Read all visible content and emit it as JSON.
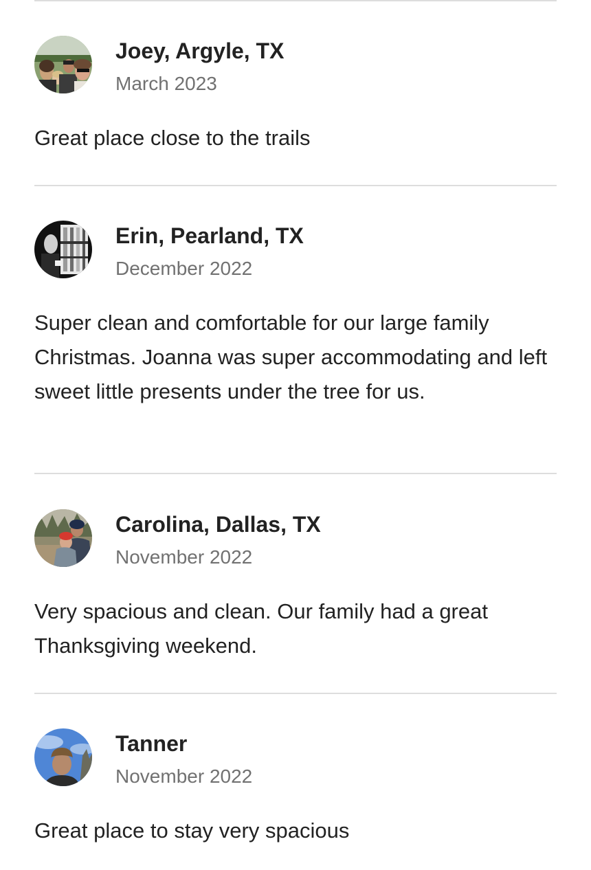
{
  "reviews": [
    {
      "name": "Joey, Argyle, TX",
      "date": "March 2023",
      "text": "Great place close to the trails",
      "avatar_icon": "family-photo-avatar"
    },
    {
      "name": "Erin, Pearland, TX",
      "date": "December 2022",
      "text": "Super clean and comfortable for our large family Christmas. Joanna was super accommodating and left sweet little presents under the tree for us.",
      "avatar_icon": "black-white-photo-avatar"
    },
    {
      "name": "Carolina, Dallas, TX",
      "date": "November 2022",
      "text": "Very spacious and clean. Our family had a great Thanksgiving weekend.",
      "avatar_icon": "couple-photo-avatar"
    },
    {
      "name": "Tanner",
      "date": "November 2022",
      "text": "Great place to stay very spacious",
      "avatar_icon": "portrait-photo-avatar"
    }
  ],
  "colors": {
    "text_primary": "#222222",
    "text_secondary": "#717171",
    "divider": "#dddddd"
  }
}
